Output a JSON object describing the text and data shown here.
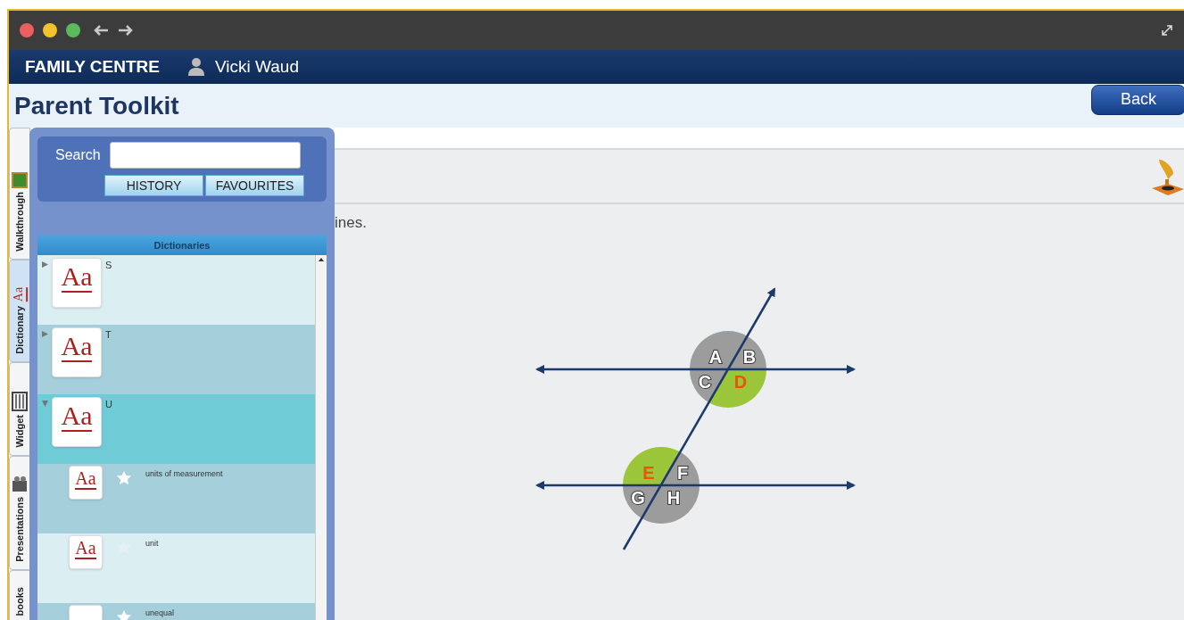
{
  "nav": {
    "brand": "FAMILY CENTRE",
    "user": "Vicki Waud"
  },
  "header": {
    "title": "Parent Toolkit",
    "back_button": "Back"
  },
  "side_tabs": [
    {
      "label": "Walkthrough",
      "selected": false,
      "kind": "board"
    },
    {
      "label": "Dictionary",
      "selected": true,
      "kind": "dictionary",
      "icon_text": "Aa"
    },
    {
      "label": "Widget",
      "selected": false,
      "kind": "widget"
    },
    {
      "label": "Presentations",
      "selected": false,
      "kind": "presentation"
    },
    {
      "label": "books",
      "selected": false,
      "kind": "none"
    }
  ],
  "dictionary_panel": {
    "search_label": "Search",
    "buttons": [
      "HISTORY",
      "FAVOURITES"
    ],
    "list_title": "Dictionaries",
    "groups": [
      {
        "letter": "S",
        "icon_text": "Aa",
        "expanded": false,
        "selected": false
      },
      {
        "letter": "T",
        "icon_text": "Aa",
        "expanded": false,
        "selected": false
      },
      {
        "letter": "U",
        "icon_text": "Aa",
        "expanded": true,
        "selected": true,
        "children": [
          {
            "term": "units of measurement",
            "icon_text": "Aa",
            "favourite": true
          },
          {
            "term": "unit",
            "icon_text": "Aa",
            "favourite": false
          },
          {
            "term": "unequal",
            "favourite": true
          }
        ]
      }
    ]
  },
  "content": {
    "text": "ines.",
    "angles": [
      {
        "label": "A",
        "highlighted": false
      },
      {
        "label": "B",
        "highlighted": false
      },
      {
        "label": "C",
        "highlighted": false
      },
      {
        "label": "D",
        "highlighted": true
      },
      {
        "label": "E",
        "highlighted": true
      },
      {
        "label": "F",
        "highlighted": false
      },
      {
        "label": "G",
        "highlighted": false
      },
      {
        "label": "H",
        "highlighted": false
      }
    ]
  }
}
